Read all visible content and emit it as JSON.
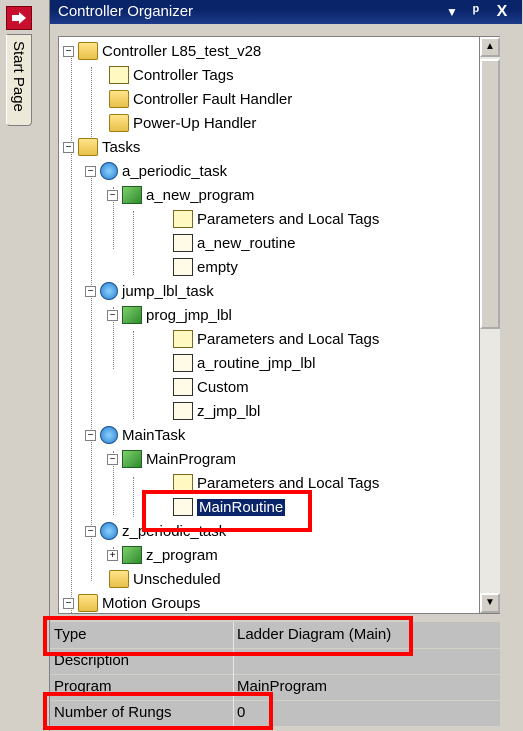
{
  "start_page_tab": "Start Page",
  "panel": {
    "title": "Controller Organizer",
    "pin_glyph": "▾ ⊥",
    "close_glyph": "X"
  },
  "tree": {
    "controller": "Controller L85_test_v28",
    "controller_tags": "Controller Tags",
    "controller_fault_handler": "Controller Fault Handler",
    "powerup_handler": "Power-Up Handler",
    "tasks": "Tasks",
    "task1": "a_periodic_task",
    "task1_program": "a_new_program",
    "task1_params": "Parameters and Local Tags",
    "task1_routine1": "a_new_routine",
    "task1_routine2": "empty",
    "task2": "jump_lbl_task",
    "task2_program": "prog_jmp_lbl",
    "task2_params": "Parameters and Local Tags",
    "task2_routine1": "a_routine_jmp_lbl",
    "task2_routine2": "Custom",
    "task2_routine3": "z_jmp_lbl",
    "task3": "MainTask",
    "task3_program": "MainProgram",
    "task3_params": "Parameters and Local Tags",
    "task3_routine": "MainRoutine",
    "task4": "z_periodic_task",
    "task4_program": "z_program",
    "unscheduled": "Unscheduled",
    "motion_groups": "Motion Groups"
  },
  "properties": {
    "type_label": "Type",
    "type_value": "Ladder Diagram (Main)",
    "description_label": "Description",
    "description_value": "",
    "program_label": "Program",
    "program_value": "MainProgram",
    "rungs_label": "Number of Rungs",
    "rungs_value": "0"
  },
  "colors": {
    "titlebar": "#0a246a",
    "highlight": "#ff0000",
    "selection": "#0a246a"
  }
}
